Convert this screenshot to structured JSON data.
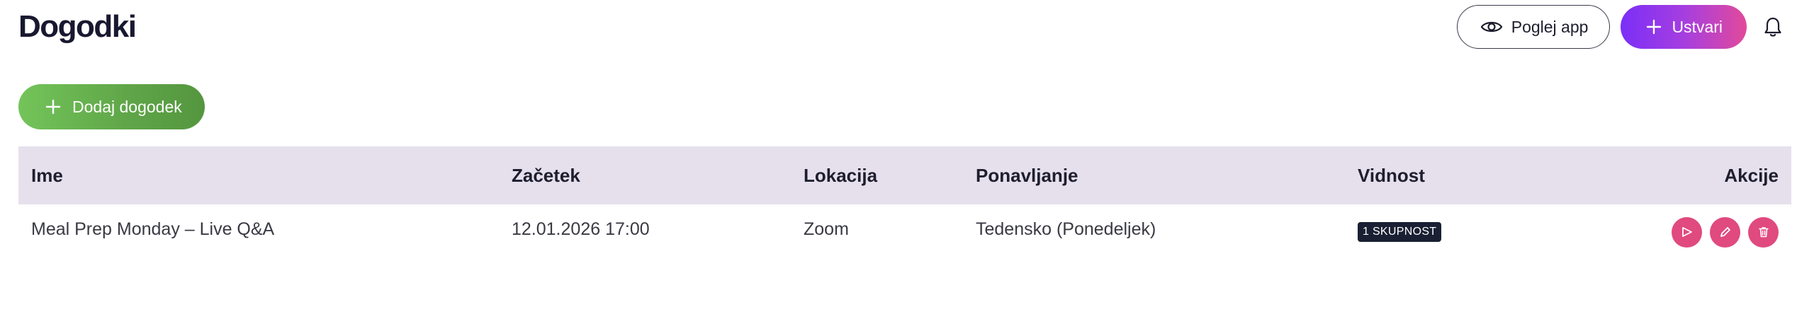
{
  "header": {
    "title": "Dogodki",
    "view_app_label": "Poglej app",
    "create_label": "Ustvari"
  },
  "toolbar": {
    "add_event_label": "Dodaj dogodek"
  },
  "table": {
    "columns": [
      "Ime",
      "Začetek",
      "Lokacija",
      "Ponavljanje",
      "Vidnost",
      "Akcije"
    ],
    "rows": [
      {
        "name": "Meal Prep Monday – Live Q&A",
        "start": "12.01.2026 17:00",
        "location": "Zoom",
        "repeat": "Tedensko (Ponedeljek)",
        "visibility": "1 SKUPNOST",
        "actions": [
          "send-icon",
          "edit-icon",
          "delete-icon"
        ]
      }
    ]
  },
  "colors": {
    "header_row_bg": "#e6e0ed",
    "create_gradient": [
      "#7b2ff7",
      "#e24a9b"
    ],
    "add_gradient": [
      "#73c45a",
      "#54963f"
    ],
    "action_button": "#e04a7e",
    "badge_bg": "#1a1f33"
  }
}
